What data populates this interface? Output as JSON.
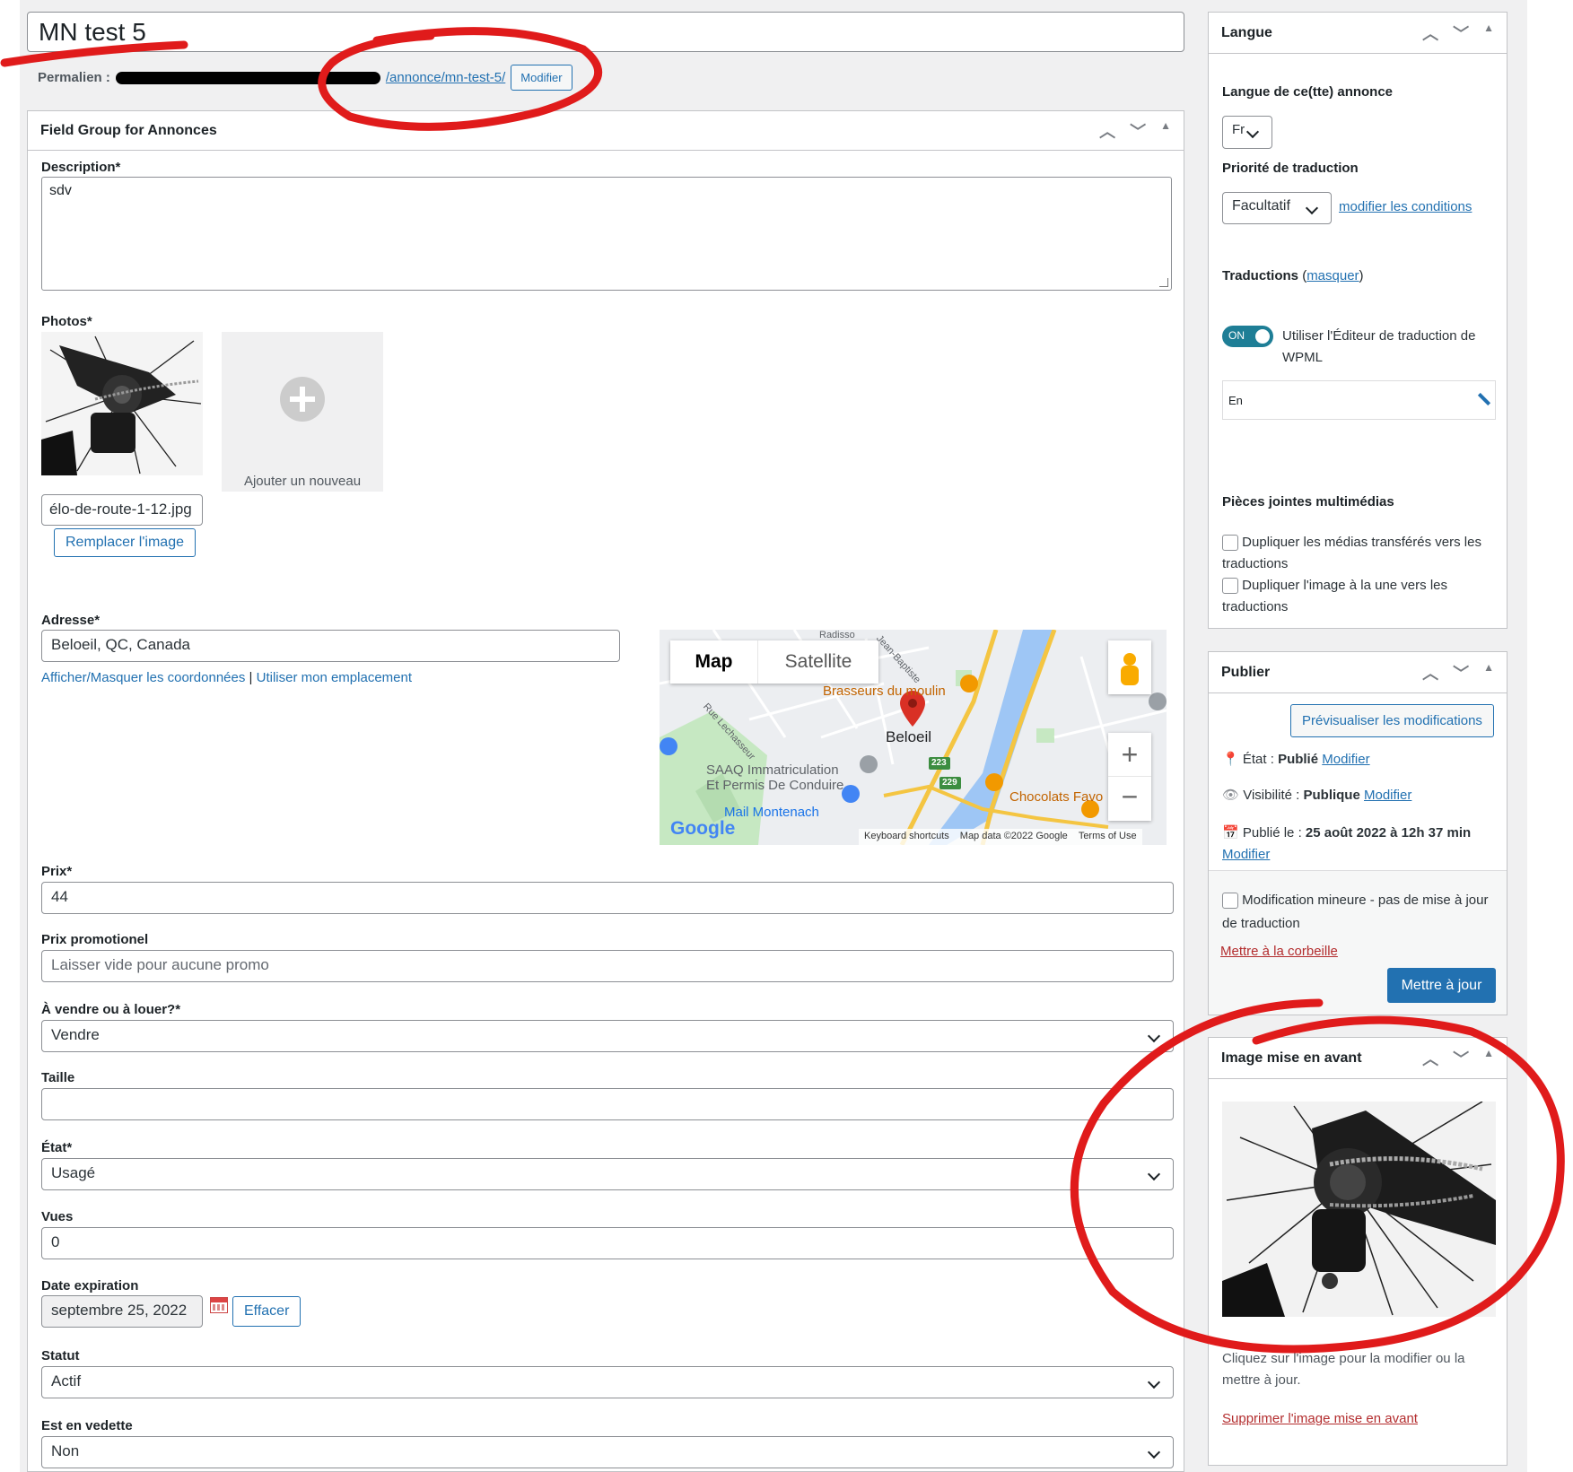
{
  "post": {
    "title": "MN test 5",
    "permalink_label": "Permalien :",
    "permalink_slug": "/annonce/mn-test-5/",
    "permalink_edit": "Modifier"
  },
  "field_group": {
    "title": "Field Group for Annonces",
    "description_label": "Description*",
    "description_value": "sdv",
    "photos_label": "Photos*",
    "photo_filename": "élo-de-route-1-12.jpg",
    "replace_image": "Remplacer l'image",
    "add_new": "Ajouter un nouveau",
    "address_label": "Adresse*",
    "address_value": "Beloeil, QC, Canada",
    "toggle_coords": "Afficher/Masquer les coordonnées",
    "separator": "|",
    "use_location": "Utiliser mon emplacement",
    "price_label": "Prix*",
    "price_value": "44",
    "promo_label": "Prix promotionel",
    "promo_placeholder": "Laisser vide pour aucune promo",
    "sale_label": "À vendre ou à louer?*",
    "sale_value": "Vendre",
    "size_label": "Taille",
    "size_value": "",
    "state_label": "État*",
    "state_value": "Usagé",
    "views_label": "Vues",
    "views_value": "0",
    "expiry_label": "Date expiration",
    "expiry_value": "septembre 25, 2022",
    "clear_btn": "Effacer",
    "status_label": "Statut",
    "status_value": "Actif",
    "featured_label": "Est en vedette",
    "featured_value": "Non"
  },
  "map": {
    "tab_map": "Map",
    "tab_satellite": "Satellite",
    "place_brasseurs": "Brasseurs du moulin",
    "place_beloeil": "Beloeil",
    "place_saaq_1": "SAAQ Immatriculation",
    "place_saaq_2": "Et Permis De Conduire",
    "place_chocolats": "Chocolats Favo",
    "place_mail": "Mail Montenach",
    "street_1": "Rue Lechasseur",
    "street_2": "Jean-Baptiste",
    "street_3": "Radisso",
    "road_223": "223",
    "road_229": "229",
    "google": "Google",
    "keyboard": "Keyboard shortcuts",
    "map_data": "Map data ©2022 Google",
    "terms": "Terms of Use"
  },
  "langue": {
    "title": "Langue",
    "lang_label": "Langue de ce(tte) annonce",
    "lang_value": "Fr",
    "priority_label": "Priorité de traduction",
    "priority_value": "Facultatif",
    "modify_conditions": "modifier les conditions",
    "translations_label": "Traductions",
    "hide_link": "masquer",
    "toggle_on": "ON",
    "use_editor": "Utiliser l'Éditeur de traduction de WPML",
    "lang_en": "En",
    "media_title": "Pièces jointes multimédias",
    "dup_media": "Dupliquer les médias transférés vers les traductions",
    "dup_featured": "Dupliquer l'image à la une vers les traductions"
  },
  "publish": {
    "title": "Publier",
    "preview": "Prévisualiser les modifications",
    "state_label": "État :",
    "state_value": "Publié",
    "visibility_label": "Visibilité :",
    "visibility_value": "Publique",
    "published_label": "Publié le :",
    "published_value": "25 août 2022 à 12h 37 min",
    "modify": "Modifier",
    "minor_edit": "Modification mineure - pas de mise à jour de traduction",
    "trash": "Mettre à la corbeille",
    "update": "Mettre à jour"
  },
  "featured_image": {
    "title": "Image mise en avant",
    "help": "Cliquez sur l'image pour la modifier ou la mettre à jour.",
    "remove": "Supprimer l'image mise en avant"
  },
  "colors": {
    "accent": "#2271b1",
    "annotation_red": "#e01b1b",
    "map_water": "#9ec6f5",
    "map_park": "#c8e6c0",
    "map_road": "#f4c542"
  }
}
